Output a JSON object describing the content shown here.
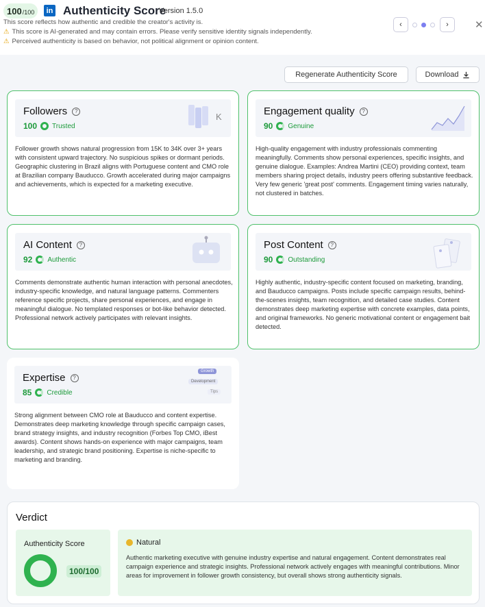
{
  "header": {
    "score_value": "100",
    "score_max": "/100",
    "title": "Authenticity Score",
    "version": "Version 1.5.0",
    "description": "This score reflects how authentic and credible the creator's activity is.",
    "warning_1": "This score is AI-generated and may contain errors. Please verify sensitive identity signals independently.",
    "warning_2": "Perceived authenticity is based on behavior, not political alignment or opinion content.",
    "prev_label": "‹",
    "next_label": "›",
    "close_label": "✕"
  },
  "actions": {
    "regenerate_label": "Regenerate Authenticity Score",
    "download_label": "Download"
  },
  "cards": [
    {
      "title": "Followers",
      "score": "100",
      "status": "Trusted",
      "body": "Follower growth shows natural progression from 15K to 34K over 3+ years with consistent upward trajectory. No suspicious spikes or dormant periods. Geographic clustering in Brazil aligns with Portuguese content and CMO role at Brazilian company Bauducco. Growth accelerated during major campaigns and achievements, which is expected for a marketing executive.",
      "deco_text": "K"
    },
    {
      "title": "Engagement quality",
      "score": "90",
      "status": "Genuine",
      "body": "High-quality engagement with industry professionals commenting meaningfully. Comments show personal experiences, specific insights, and genuine dialogue. Examples: Andrea Martini (CEO) providing context, team members sharing project details, industry peers offering substantive feedback. Very few generic 'great post' comments. Engagement timing varies naturally, not clustered in batches."
    },
    {
      "title": "AI Content",
      "score": "92",
      "status": "Authentic",
      "body": "Comments demonstrate authentic human interaction with personal anecdotes, industry-specific knowledge, and natural language patterns. Commenters reference specific projects, share personal experiences, and engage in meaningful dialogue. No templated responses or bot-like behavior detected. Professional network actively participates with relevant insights."
    },
    {
      "title": "Post Content",
      "score": "90",
      "status": "Outstanding",
      "body": "Highly authentic, industry-specific content focused on marketing, branding, and Bauducco campaigns. Posts include specific campaign results, behind-the-scenes insights, team recognition, and detailed case studies. Content demonstrates deep marketing expertise with concrete examples, data points, and original frameworks. No generic motivational content or engagement bait detected."
    },
    {
      "title": "Expertise",
      "score": "85",
      "status": "Credible",
      "body": "Strong alignment between CMO role at Bauducco and content expertise. Demonstrates deep marketing knowledge through specific campaign cases, brand strategy insights, and industry recognition (Forbes Top CMO, iBest awards). Content shows hands-on experience with major campaigns, team leadership, and strategic brand positioning. Expertise is niche-specific to marketing and branding.",
      "deco_labels": [
        "Growth",
        "Development",
        "Tips"
      ]
    }
  ],
  "verdict": {
    "title": "Verdict",
    "score_label": "Authenticity Score",
    "score": "100/100",
    "badge": "Natural",
    "text": "Authentic marketing executive with genuine industry expertise and natural engagement. Content demonstrates real campaign experience and strategic insights. Professional network actively engages with meaningful contributions. Minor areas for improvement in follower growth consistency, but overall shows strong authenticity signals."
  },
  "colors": {
    "accent_green": "#2fb24f",
    "linkedin_blue": "#0a66c2",
    "active_dot": "#7c7ff0",
    "warning": "#e5a100"
  },
  "icons": [
    "linkedin-icon",
    "warning-icon",
    "chevron-left-icon",
    "chevron-right-icon",
    "close-icon",
    "download-icon",
    "help-icon",
    "robot-icon",
    "documents-icon",
    "chart-icon"
  ]
}
